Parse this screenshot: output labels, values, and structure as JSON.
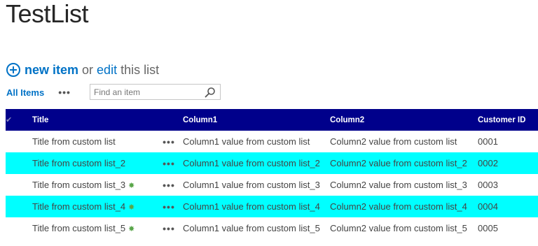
{
  "page": {
    "title": "TestList"
  },
  "command": {
    "new_item": "new item",
    "or": "or",
    "edit": "edit",
    "this_list": "this list"
  },
  "view": {
    "all_items": "All Items",
    "ellipsis": "•••",
    "search_placeholder": "Find an item"
  },
  "table": {
    "headers": {
      "title": "Title",
      "column1": "Column1",
      "column2": "Column2",
      "customer_id": "Customer ID"
    },
    "rows": [
      {
        "title": "Title from custom list",
        "column1": "Column1 value from custom list",
        "column2": "Column2 value from custom list",
        "customer_id": "0001",
        "is_new": false,
        "highlighted": false
      },
      {
        "title": "Title from custom list_2",
        "column1": "Column1 value from custom list_2",
        "column2": "Column2 value from custom list_2",
        "customer_id": "0002",
        "is_new": false,
        "highlighted": true
      },
      {
        "title": "Title from custom list_3",
        "column1": "Column1 value from custom list_3",
        "column2": "Column2 value from custom list_3",
        "customer_id": "0003",
        "is_new": true,
        "highlighted": false
      },
      {
        "title": "Title from custom list_4",
        "column1": "Column1 value from custom list_4",
        "column2": "Column2 value from custom list_4",
        "customer_id": "0004",
        "is_new": true,
        "highlighted": true
      },
      {
        "title": "Title from custom list_5",
        "column1": "Column1 value from custom list_5",
        "column2": "Column2 value from custom list_5",
        "customer_id": "0005",
        "is_new": true,
        "highlighted": false
      }
    ],
    "row_menu": "•••",
    "new_icon": "✸"
  },
  "colors": {
    "header_bg": "#00008b",
    "highlight_bg": "#00ffff",
    "link": "#0072c6",
    "new_icon": "#59a64a"
  }
}
